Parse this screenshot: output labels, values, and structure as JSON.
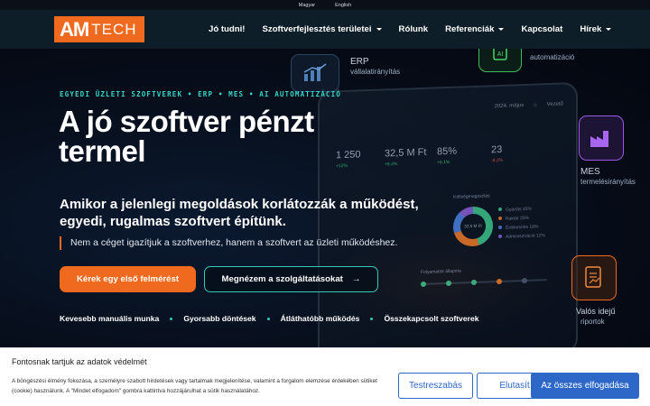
{
  "languages": [
    "Magyar",
    "English"
  ],
  "brand": {
    "logo_am": "AM",
    "logo_tech": "TECH",
    "accent": "#ef6a1e",
    "teal": "#35c9b9"
  },
  "nav": [
    {
      "label": "Jó tudni!",
      "dropdown": false
    },
    {
      "label": "Szoftverfejlesztés területei",
      "dropdown": true
    },
    {
      "label": "Rólunk",
      "dropdown": false
    },
    {
      "label": "Referenciák",
      "dropdown": true
    },
    {
      "label": "Kapcsolat",
      "dropdown": false
    },
    {
      "label": "Hírek",
      "dropdown": true
    }
  ],
  "hero": {
    "tagline": "EGYEDI ÜZLETI SZOFTVEREK • ERP • MES • AI AUTOMATIZÁCIÓ",
    "headline": "A jó szoftver pénzt termel",
    "subhead": "Amikor a jelenlegi megoldások korlátozzák a működést, egyedi, rugalmas szoftvert építünk.",
    "quote": "Nem a céget igazítjuk a szoftverhez, hanem a szoftvert az üzleti működéshez.",
    "cta_primary": "Kérek egy első felmérést",
    "cta_secondary": "Megnézem a szolgáltatásokat",
    "cta_arrow": "→",
    "benefits": [
      "Kevesebb manuális munka",
      "Gyorsabb döntések",
      "Átláthatóbb működés",
      "Összekapcsolt szoftverek"
    ]
  },
  "floating": {
    "erp_title": "ERP",
    "erp_sub": "vállalatirányítás",
    "ai_sub": "automatizáció",
    "mes_title": "MES",
    "mes_sub": "termelésirányítás",
    "report_title": "Valós idejű",
    "report_sub": "riportok"
  },
  "dashboard": {
    "period": "2024. május",
    "user": "Vezető",
    "kpis": [
      {
        "value": "1 250",
        "delta": "+12%"
      },
      {
        "value": "32,5 M Ft",
        "delta": "+8,4%"
      },
      {
        "value": "85%",
        "delta": "+6,1%"
      },
      {
        "value": "23",
        "delta": "-8,2%"
      }
    ],
    "donut_title": "Költségmegoszlás",
    "donut_center": "32,5 M Ft",
    "legend": [
      "Gyártás 45%",
      "Raktár 25%",
      "Értékesítés 18%",
      "Adminisztráció 12%"
    ],
    "process_title": "Folyamatok állapota"
  },
  "cookie": {
    "title": "Fontosnak tartjuk az adatok védelmét",
    "text": "A böngészési élmény fokozása, a személyre szabott hirdetések vagy tartalmak megjelenítése, valamint a forgalom elemzése érdekében sütiket (cookie) használunk. A \"Mindet elfogadom\" gombra kattintva hozzájárulhat a sütik használatához.",
    "customize": "Testreszabás",
    "reject": "Elutasít",
    "accept": "Az összes elfogadása"
  }
}
